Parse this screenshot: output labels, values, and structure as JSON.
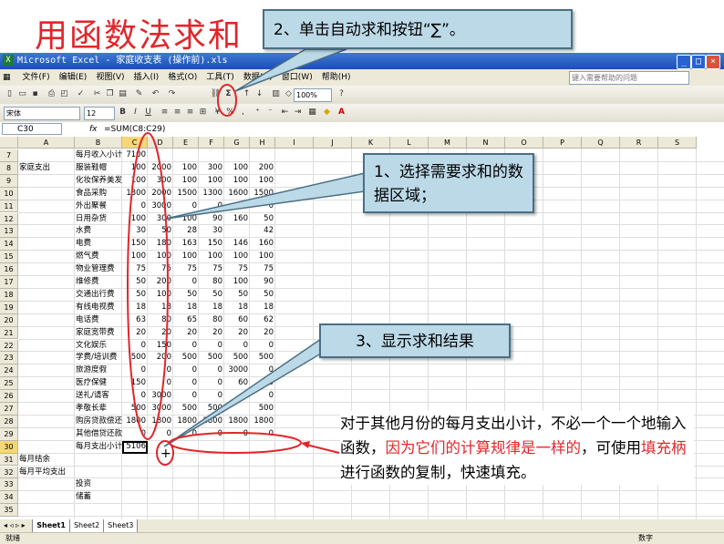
{
  "slide": {
    "title": "用函数法求和",
    "callout_sum_button": "2、单击自动求和按钮“∑”。",
    "callout_select": "1、选择需要求和的数据区域；",
    "callout_result": "3、显示求和结果",
    "note_parts": [
      {
        "text": "对于其他月份的每月支出小计，不必一个一个地输入函数，",
        "red": false
      },
      {
        "text": "因为它们的计算规律是一样的",
        "red": true
      },
      {
        "text": "，可使用",
        "red": false
      },
      {
        "text": "填充柄",
        "red": true
      },
      {
        "text": "进行函数的复制，快速填充。",
        "red": false
      }
    ],
    "colors": {
      "title_red": "#e0262b",
      "callout_bg": "#bcd9e8",
      "ellipse_red": "#e0262b"
    }
  },
  "excel": {
    "window_title": "Microsoft Excel - 家庭收支表 (操作前).xls",
    "menu": [
      "文件(F)",
      "编辑(E)",
      "视图(V)",
      "插入(I)",
      "格式(O)",
      "工具(T)",
      "数据(D)",
      "窗口(W)",
      "帮助(H)"
    ],
    "help_placeholder": "键入需要帮助的问题",
    "font_name": "宋体",
    "font_size": "12",
    "zoom": "100%",
    "name_box": "C30",
    "formula": "=SUM(C8:C29)",
    "columns": [
      "A",
      "B",
      "C",
      "D",
      "E",
      "F",
      "G",
      "H",
      "I",
      "J",
      "K",
      "L",
      "M",
      "N",
      "O",
      "P",
      "Q",
      "R",
      "S"
    ],
    "rows": [
      {
        "n": "7",
        "a": "",
        "b": "每月收入小计",
        "c": "7100",
        "d": "",
        "e": "",
        "f": "",
        "g": "",
        "h": ""
      },
      {
        "n": "8",
        "a": "家庭支出",
        "b": "服装鞋帽",
        "c": "100",
        "d": "2000",
        "e": "100",
        "f": "300",
        "g": "100",
        "h": "200"
      },
      {
        "n": "9",
        "a": "",
        "b": "化妆保养美发",
        "c": "100",
        "d": "300",
        "e": "100",
        "f": "100",
        "g": "100",
        "h": "100"
      },
      {
        "n": "10",
        "a": "",
        "b": "食品采购",
        "c": "1300",
        "d": "2000",
        "e": "1500",
        "f": "1300",
        "g": "1600",
        "h": "1500"
      },
      {
        "n": "11",
        "a": "",
        "b": "外出聚餐",
        "c": "0",
        "d": "3000",
        "e": "0",
        "f": "0",
        "g": "0",
        "h": "0"
      },
      {
        "n": "12",
        "a": "",
        "b": "日用杂货",
        "c": "100",
        "d": "300",
        "e": "100",
        "f": "90",
        "g": "160",
        "h": "50"
      },
      {
        "n": "13",
        "a": "",
        "b": "水费",
        "c": "30",
        "d": "50",
        "e": "28",
        "f": "30",
        "g": "",
        "h": "42"
      },
      {
        "n": "14",
        "a": "",
        "b": "电费",
        "c": "150",
        "d": "180",
        "e": "163",
        "f": "150",
        "g": "146",
        "h": "160"
      },
      {
        "n": "15",
        "a": "",
        "b": "燃气费",
        "c": "100",
        "d": "100",
        "e": "100",
        "f": "100",
        "g": "100",
        "h": "100"
      },
      {
        "n": "16",
        "a": "",
        "b": "物业管理费",
        "c": "75",
        "d": "75",
        "e": "75",
        "f": "75",
        "g": "75",
        "h": "75"
      },
      {
        "n": "17",
        "a": "",
        "b": "维修费",
        "c": "50",
        "d": "200",
        "e": "0",
        "f": "80",
        "g": "100",
        "h": "90"
      },
      {
        "n": "18",
        "a": "",
        "b": "交通出行费",
        "c": "50",
        "d": "100",
        "e": "50",
        "f": "50",
        "g": "50",
        "h": "50"
      },
      {
        "n": "19",
        "a": "",
        "b": "有线电视费",
        "c": "18",
        "d": "18",
        "e": "18",
        "f": "18",
        "g": "18",
        "h": "18"
      },
      {
        "n": "20",
        "a": "",
        "b": "电话费",
        "c": "63",
        "d": "80",
        "e": "65",
        "f": "80",
        "g": "60",
        "h": "62"
      },
      {
        "n": "21",
        "a": "",
        "b": "家庭宽带费",
        "c": "20",
        "d": "20",
        "e": "20",
        "f": "20",
        "g": "20",
        "h": "20"
      },
      {
        "n": "22",
        "a": "",
        "b": "文化娱乐",
        "c": "0",
        "d": "150",
        "e": "0",
        "f": "0",
        "g": "0",
        "h": "0"
      },
      {
        "n": "23",
        "a": "",
        "b": "学费/培训费",
        "c": "500",
        "d": "200",
        "e": "500",
        "f": "500",
        "g": "500",
        "h": "500"
      },
      {
        "n": "24",
        "a": "",
        "b": "旅游度假",
        "c": "0",
        "d": "0",
        "e": "0",
        "f": "0",
        "g": "3000",
        "h": "0"
      },
      {
        "n": "25",
        "a": "",
        "b": "医疗保健",
        "c": "150",
        "d": "0",
        "e": "0",
        "f": "0",
        "g": "60",
        "h": "0"
      },
      {
        "n": "26",
        "a": "",
        "b": "送礼/请客",
        "c": "0",
        "d": "3000",
        "e": "0",
        "f": "0",
        "g": "0",
        "h": "0"
      },
      {
        "n": "27",
        "a": "",
        "b": "孝敬长辈",
        "c": "500",
        "d": "3000",
        "e": "500",
        "f": "500",
        "g": "",
        "h": "500"
      },
      {
        "n": "28",
        "a": "",
        "b": "购房贷款偿还",
        "c": "1800",
        "d": "1800",
        "e": "1800",
        "f": "1800",
        "g": "1800",
        "h": "1800"
      },
      {
        "n": "29",
        "a": "",
        "b": "其他借贷还款",
        "c": "0",
        "d": "0",
        "e": "0",
        "f": "0",
        "g": "0",
        "h": "0"
      },
      {
        "n": "30",
        "a": "",
        "b": "每月支出小计",
        "c": "5106",
        "d": "",
        "e": "",
        "f": "",
        "g": "",
        "h": ""
      },
      {
        "n": "31",
        "a": "每月结余",
        "b": "",
        "c": "",
        "d": "",
        "e": "",
        "f": "",
        "g": "",
        "h": ""
      },
      {
        "n": "32",
        "a": "每月平均支出",
        "b": "",
        "c": "",
        "d": "",
        "e": "",
        "f": "",
        "g": "",
        "h": ""
      },
      {
        "n": "33",
        "a": "",
        "b": "投资",
        "c": "",
        "d": "",
        "e": "",
        "f": "",
        "g": "",
        "h": ""
      },
      {
        "n": "34",
        "a": "",
        "b": "储蓄",
        "c": "",
        "d": "",
        "e": "",
        "f": "",
        "g": "",
        "h": ""
      },
      {
        "n": "35",
        "a": "",
        "b": "",
        "c": "",
        "d": "",
        "e": "",
        "f": "",
        "g": "",
        "h": ""
      }
    ],
    "sheets": [
      "Sheet1",
      "Sheet2",
      "Sheet3"
    ],
    "status_left": "就绪",
    "status_right": "数字"
  }
}
